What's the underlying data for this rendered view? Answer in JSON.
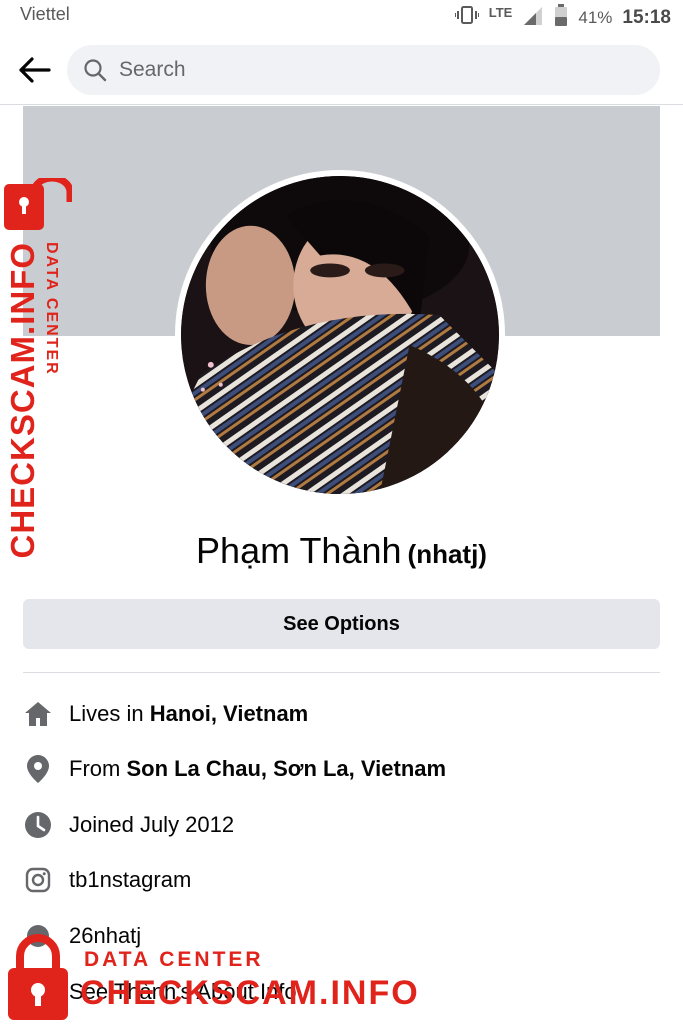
{
  "status_bar": {
    "carrier": "Viettel",
    "network": "LTE",
    "battery": "41%",
    "time": "15:18"
  },
  "header": {
    "search_placeholder": "Search"
  },
  "profile": {
    "name": "Phạm Thành",
    "alt_name": "(nhatj)",
    "see_options_label": "See Options"
  },
  "info": {
    "lives_prefix": "Lives in ",
    "lives_place": "Hanoi, Vietnam",
    "from_prefix": "From ",
    "from_place": "Son La Chau, Sơn La, Vietnam",
    "joined": "Joined July 2012",
    "instagram": "tb1nstagram",
    "other_handle": "26nhatj",
    "about_link": "See Thành's About Info"
  },
  "watermark": {
    "top_line": "DATA CENTER",
    "brand": "CHECKSCAM.INFO"
  },
  "colors": {
    "accent_red": "#e0231b",
    "cover_gray": "#c9cdd2",
    "button_gray": "#e4e6eb"
  }
}
